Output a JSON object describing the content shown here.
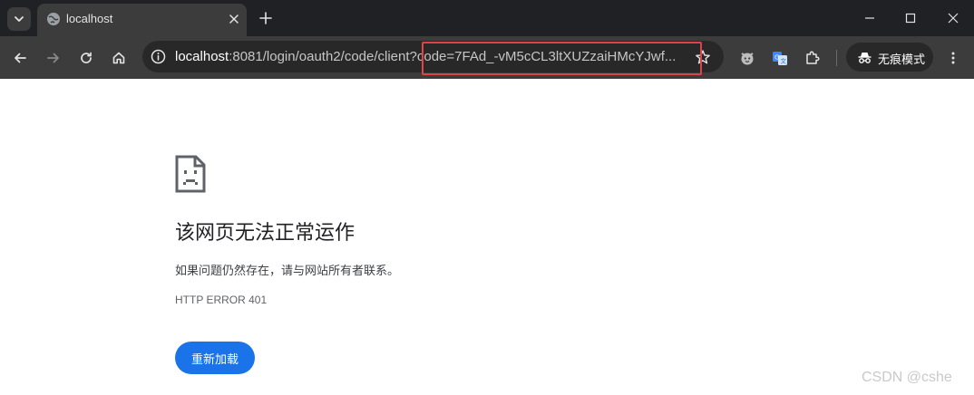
{
  "tab": {
    "title": "localhost"
  },
  "omnibox": {
    "host": "localhost",
    "path": ":8081/login/oauth2/code/client?code=7FAd_-vM5cCL3ltXUZzaiHMcYJwf..."
  },
  "incognito": {
    "label": "无痕模式"
  },
  "error": {
    "title": "该网页无法正常运作",
    "description": "如果问题仍然存在，请与网站所有者联系。",
    "code": "HTTP ERROR 401",
    "reload_label": "重新加载"
  },
  "watermark": "CSDN @cshe",
  "colors": {
    "accent": "#1a73e8",
    "highlight": "#e0424a",
    "toolbar": "#3c3c3c",
    "tabstrip": "#202124"
  },
  "icons": {
    "tab_search": "chevron-down-icon",
    "favicon": "globe-icon",
    "back": "arrow-left-icon",
    "forward": "arrow-right-icon",
    "reload": "reload-icon",
    "home": "home-icon",
    "info": "info-icon",
    "star": "star-icon",
    "extensions": [
      "fox-extension-icon",
      "translate-extension-icon",
      "puzzle-icon"
    ],
    "incognito": "incognito-icon",
    "menu": "kebab-menu-icon",
    "error": "sad-page-icon"
  }
}
